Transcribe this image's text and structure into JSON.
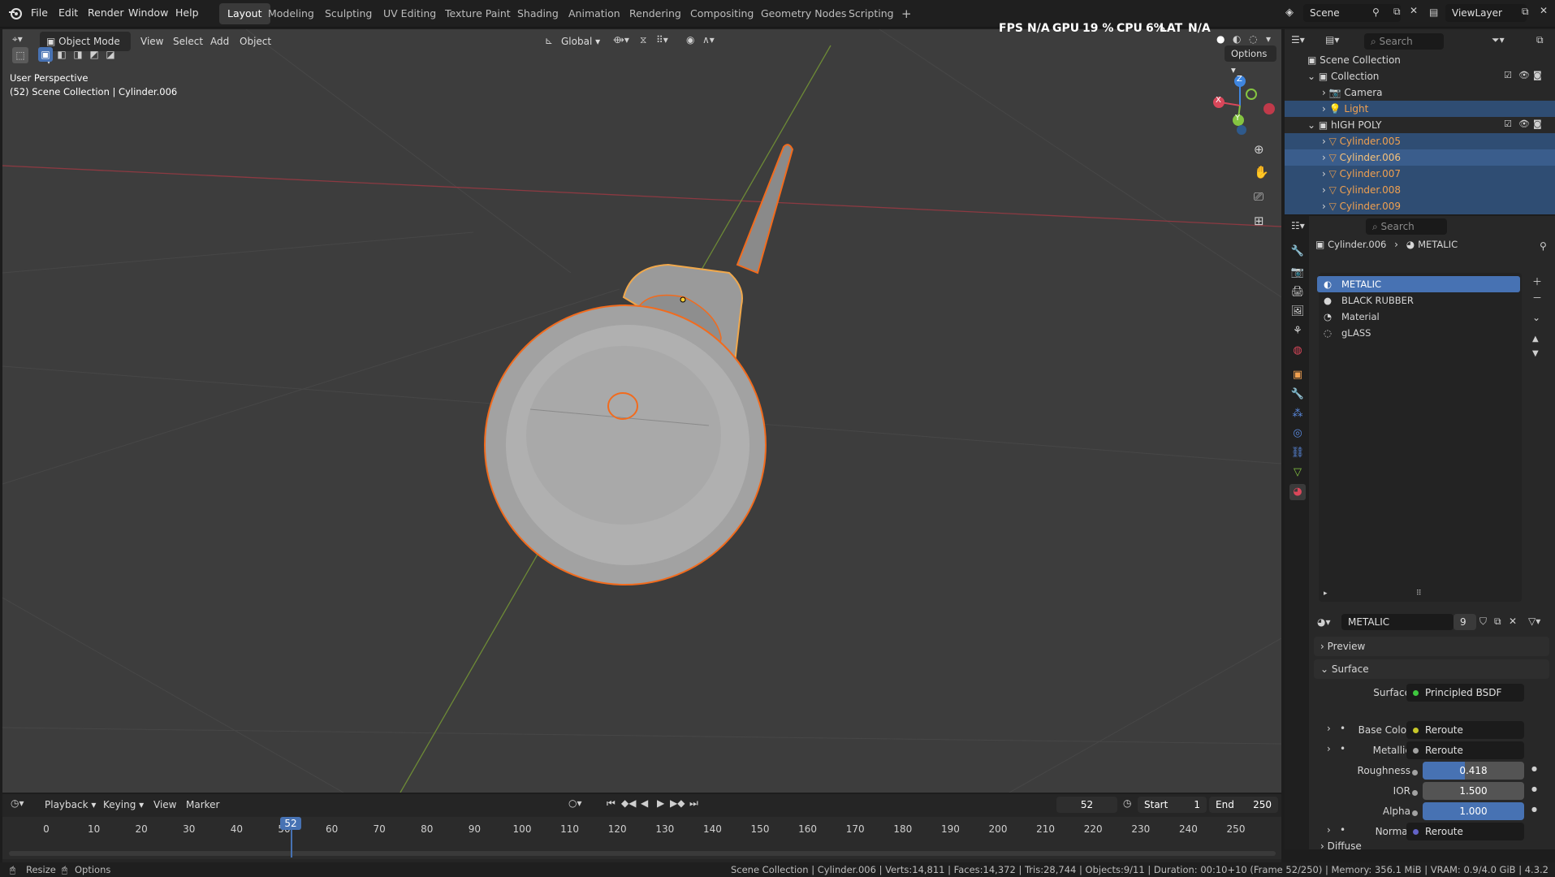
{
  "topbar": {
    "menus": [
      "File",
      "Edit",
      "Render",
      "Window",
      "Help"
    ],
    "workspaces": [
      "Layout",
      "Modeling",
      "Sculpting",
      "UV Editing",
      "Texture Paint",
      "Shading",
      "Animation",
      "Rendering",
      "Compositing",
      "Geometry Nodes",
      "Scripting"
    ],
    "active_workspace": "Layout",
    "add_tab": "+",
    "scene": "Scene",
    "view_layer": "ViewLayer"
  },
  "viewport_header": {
    "mode": "Object Mode",
    "menus": [
      "View",
      "Select",
      "Add",
      "Object"
    ],
    "orientation": "Global",
    "options": "Options",
    "stats": {
      "fps_label": "FPS",
      "fps_value": "N/A",
      "gpu_label": "GPU",
      "gpu_value": "19 %",
      "cpu_label": "CPU",
      "cpu_value": "6%",
      "lat_label": "LAT",
      "lat_value": "N/A"
    }
  },
  "viewport": {
    "perspective": "User Perspective",
    "info": "(52) Scene Collection | Cylinder.006",
    "gizmo": {
      "x": "X",
      "y": "Y",
      "z": "Z"
    }
  },
  "outliner": {
    "search_placeholder": "Search",
    "root": "Scene Collection",
    "rows": [
      {
        "label": "Collection",
        "type": "collection"
      },
      {
        "label": "Camera",
        "type": "camera"
      },
      {
        "label": "Light",
        "type": "light"
      },
      {
        "label": "hIGH POLY",
        "type": "collection"
      },
      {
        "label": "Cylinder.005",
        "type": "mesh"
      },
      {
        "label": "Cylinder.006",
        "type": "mesh"
      },
      {
        "label": "Cylinder.007",
        "type": "mesh"
      },
      {
        "label": "Cylinder.008",
        "type": "mesh"
      },
      {
        "label": "Cylinder.009",
        "type": "mesh"
      }
    ]
  },
  "properties": {
    "search_placeholder": "Search",
    "breadcrumb_object": "Cylinder.006",
    "breadcrumb_material": "METALIC",
    "material_slots": [
      "METALIC",
      "BLACK RUBBER",
      "Material",
      "gLASS"
    ],
    "active_material": "METALIC",
    "material_name": "METALIC",
    "user_count": "9",
    "panels": {
      "preview": "Preview",
      "surface": "Surface",
      "diffuse": "Diffuse"
    },
    "surface_shader_label": "Surface",
    "surface_shader": "Principled BSDF",
    "inputs": [
      {
        "label": "Base Color",
        "value": "Reroute",
        "kind": "link",
        "socket": "#c7c729"
      },
      {
        "label": "Metallic",
        "value": "Reroute",
        "kind": "link",
        "socket": "#a1a1a1"
      },
      {
        "label": "Roughness",
        "value": "0.418",
        "kind": "number",
        "fill": 0.418,
        "socket": "#a1a1a1"
      },
      {
        "label": "IOR",
        "value": "1.500",
        "kind": "number",
        "fill": 0,
        "socket": "#a1a1a1"
      },
      {
        "label": "Alpha",
        "value": "1.000",
        "kind": "number",
        "fill": 1.0,
        "socket": "#a1a1a1"
      },
      {
        "label": "Normal",
        "value": "Reroute",
        "kind": "link",
        "socket": "#6363c7"
      }
    ]
  },
  "timeline": {
    "menus": [
      "Playback",
      "Keying",
      "View",
      "Marker"
    ],
    "current_frame": "52",
    "start_label": "Start",
    "start": "1",
    "end_label": "End",
    "end": "250",
    "ticks": [
      "0",
      "10",
      "20",
      "30",
      "40",
      "50",
      "60",
      "70",
      "80",
      "90",
      "100",
      "110",
      "120",
      "130",
      "140",
      "150",
      "160",
      "170",
      "180",
      "190",
      "200",
      "210",
      "220",
      "230",
      "240",
      "250"
    ]
  },
  "statusbar": {
    "left1": "Resize",
    "left2": "Options",
    "right": "Scene Collection | Cylinder.006 | Verts:14,811 | Faces:14,372 | Tris:28,744 | Objects:9/11 | Duration: 00:10+10 (Frame 52/250) | Memory: 356.1 MiB | VRAM: 0.9/4.0 GiB | 4.3.2"
  },
  "colors": {
    "accent": "#4772b3",
    "selection": "#f26b1d",
    "x_axis": "#d9475a",
    "y_axis": "#85c441",
    "z_axis": "#3f86e0"
  }
}
